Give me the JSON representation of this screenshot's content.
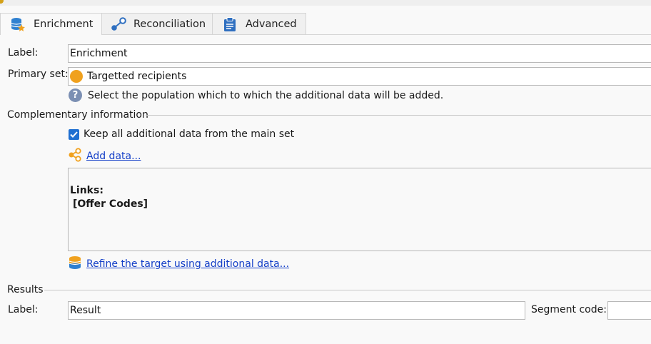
{
  "tabs": [
    {
      "label": "Enrichment",
      "icon": "database-star-icon",
      "active": true
    },
    {
      "label": "Reconciliation",
      "icon": "link-nodes-icon",
      "active": false
    },
    {
      "label": "Advanced",
      "icon": "clipboard-icon",
      "active": false
    }
  ],
  "form": {
    "label_caption": "Label:",
    "label_value": "Enrichment",
    "primary_caption": "Primary set:",
    "primary_value": "Targetted recipients",
    "help_text": "Select the population which to which the additional data will be added."
  },
  "complementary": {
    "title": "Complementary information",
    "keep_label": "Keep all additional data from the main set",
    "keep_checked": true,
    "add_link": "Add data...",
    "links_title": "Links:",
    "links_items": [
      "[Offer Codes]"
    ],
    "refine_link": "Refine the target using additional data..."
  },
  "results": {
    "title": "Results",
    "label_caption": "Label:",
    "label_value": "Result",
    "segment_caption": "Segment code:",
    "segment_value": ""
  },
  "colors": {
    "primary_circle": "#f0a11e",
    "link": "#1540c8",
    "checkbox": "#1f6fd1"
  }
}
